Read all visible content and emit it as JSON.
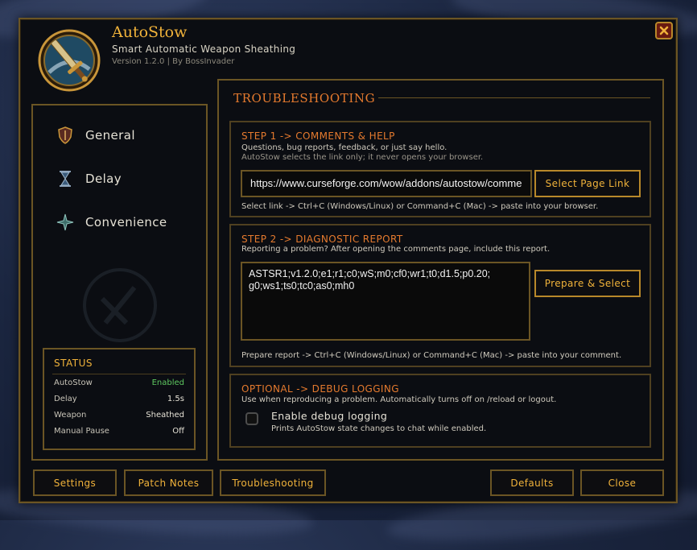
{
  "app": {
    "title": "AutoStow",
    "subtitle": "Smart Automatic Weapon Sheathing",
    "version": "Version 1.2.0 | By BossInvader"
  },
  "sidebar": {
    "items": [
      {
        "label": "General",
        "icon": "shield-icon"
      },
      {
        "label": "Delay",
        "icon": "hourglass-icon"
      },
      {
        "label": "Convenience",
        "icon": "star-icon"
      }
    ]
  },
  "status": {
    "title": "STATUS",
    "rows": [
      {
        "label": "AutoStow",
        "value": "Enabled"
      },
      {
        "label": "Delay",
        "value": "1.5s"
      },
      {
        "label": "Weapon",
        "value": "Sheathed"
      },
      {
        "label": "Manual Pause",
        "value": "Off"
      }
    ]
  },
  "main": {
    "title": "TROUBLESHOOTING",
    "step1": {
      "title": "STEP 1 -> COMMENTS & HELP",
      "line1": "Questions, bug reports, feedback, or just say hello.",
      "line2": "AutoStow selects the link only; it never opens your browser.",
      "link_value": "https://www.curseforge.com/wow/addons/autostow/comme",
      "button": "Select Page Link",
      "hint": "Select link -> Ctrl+C (Windows/Linux) or Command+C (Mac) -> paste into your browser."
    },
    "step2": {
      "title": "STEP 2 -> DIAGNOSTIC REPORT",
      "line1": "Reporting a problem? After opening the comments page, include this report.",
      "report_line1": "ASTSR1;v1.2.0;e1;r1;c0;wS;m0;cf0;wr1;t0;d1.5;p0.20;",
      "report_line2": "g0;ws1;ts0;tc0;as0;mh0",
      "button": "Prepare & Select",
      "hint": "Prepare report -> Ctrl+C (Windows/Linux) or Command+C (Mac) -> paste into your comment."
    },
    "optional": {
      "title": "OPTIONAL -> DEBUG LOGGING",
      "line1": "Use when reproducing a problem. Automatically turns off on /reload or logout.",
      "checkbox_label": "Enable debug logging",
      "checkbox_desc": "Prints AutoStow state changes to chat while enabled.",
      "checked": false
    }
  },
  "footer": {
    "settings": "Settings",
    "patch_notes": "Patch Notes",
    "troubleshooting": "Troubleshooting",
    "defaults": "Defaults",
    "close": "Close"
  },
  "colors": {
    "accent_gold": "#f0b23a",
    "section_orange": "#e57a2e",
    "border": "#6b5524",
    "enabled_green": "#5ec860"
  }
}
